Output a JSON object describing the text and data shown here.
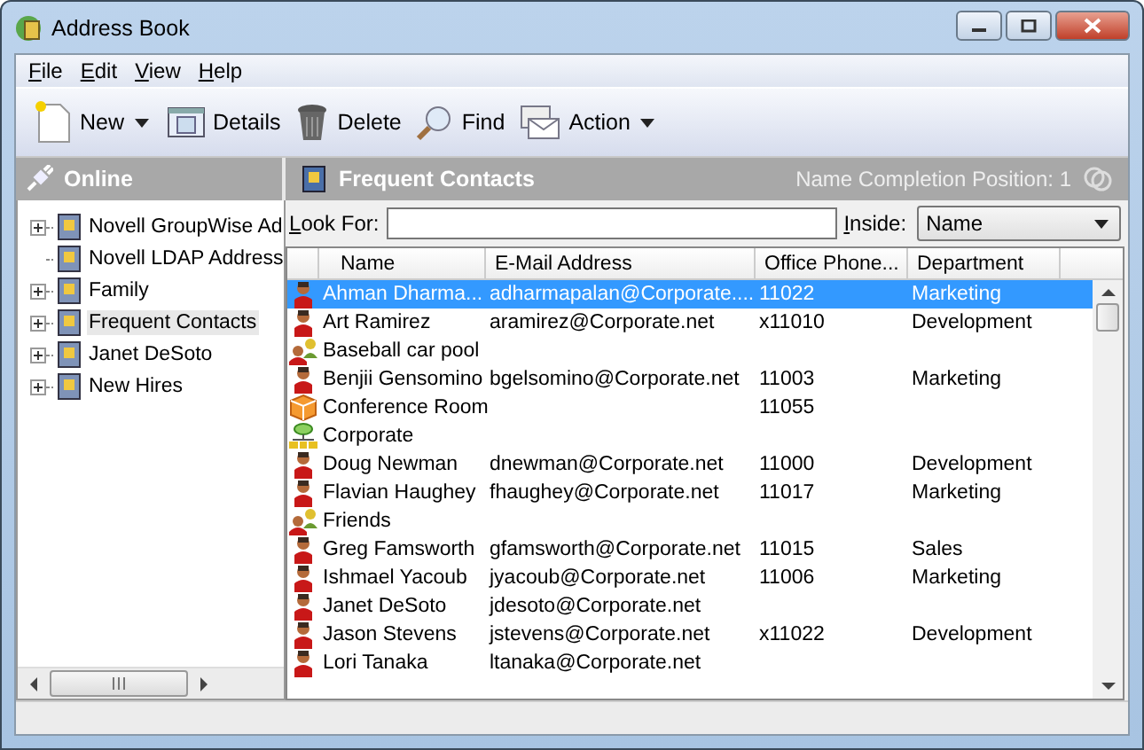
{
  "window": {
    "title": "Address Book"
  },
  "menu": [
    "File",
    "Edit",
    "View",
    "Help"
  ],
  "toolbar": [
    {
      "label": "New",
      "kind": "new",
      "dropdown": true
    },
    {
      "label": "Details",
      "kind": "details",
      "dropdown": false
    },
    {
      "label": "Delete",
      "kind": "delete",
      "dropdown": false
    },
    {
      "label": "Find",
      "kind": "find",
      "dropdown": false
    },
    {
      "label": "Action",
      "kind": "action",
      "dropdown": true
    }
  ],
  "sidebar": {
    "title": "Online",
    "items": [
      {
        "label": "Novell GroupWise Ad",
        "expandable": true,
        "selected": false
      },
      {
        "label": "Novell LDAP Address",
        "expandable": false,
        "selected": false
      },
      {
        "label": "Family",
        "expandable": true,
        "selected": false
      },
      {
        "label": "Frequent Contacts",
        "expandable": true,
        "selected": true
      },
      {
        "label": "Janet DeSoto",
        "expandable": true,
        "selected": false
      },
      {
        "label": "New Hires",
        "expandable": true,
        "selected": false
      }
    ]
  },
  "panel": {
    "title": "Frequent Contacts",
    "completion": "Name Completion Position: 1"
  },
  "search": {
    "label": "Look For:",
    "inside_label": "Inside:",
    "inside_value": "Name"
  },
  "table": {
    "columns": [
      "Name",
      "E-Mail Address",
      "Office Phone...",
      "Department"
    ],
    "rows": [
      {
        "kind": "person",
        "selected": true,
        "cells": [
          "Ahman Dharma...",
          "adharmapalan@Corporate....",
          "11022",
          "Marketing"
        ]
      },
      {
        "kind": "person",
        "selected": false,
        "cells": [
          "Art Ramirez",
          "aramirez@Corporate.net",
          "x11010",
          "Development"
        ]
      },
      {
        "kind": "group",
        "selected": false,
        "cells": [
          "Baseball car pool"
        ]
      },
      {
        "kind": "person",
        "selected": false,
        "cells": [
          "Benjii Gensomino",
          "bgelsomino@Corporate.net",
          "11003",
          "Marketing"
        ]
      },
      {
        "kind": "resource",
        "selected": false,
        "cells": [
          "Conference Room",
          "",
          "11055"
        ]
      },
      {
        "kind": "org",
        "selected": false,
        "cells": [
          "Corporate"
        ]
      },
      {
        "kind": "person",
        "selected": false,
        "cells": [
          "Doug Newman",
          "dnewman@Corporate.net",
          "11000",
          "Development"
        ]
      },
      {
        "kind": "person",
        "selected": false,
        "cells": [
          "Flavian Haughey",
          "fhaughey@Corporate.net",
          "11017",
          "Marketing"
        ]
      },
      {
        "kind": "group",
        "selected": false,
        "cells": [
          "Friends"
        ]
      },
      {
        "kind": "person",
        "selected": false,
        "cells": [
          "Greg Famsworth",
          "gfamsworth@Corporate.net",
          "11015",
          "Sales"
        ]
      },
      {
        "kind": "person",
        "selected": false,
        "cells": [
          "Ishmael Yacoub",
          "jyacoub@Corporate.net",
          "11006",
          "Marketing"
        ]
      },
      {
        "kind": "person",
        "selected": false,
        "cells": [
          "Janet DeSoto",
          "jdesoto@Corporate.net"
        ]
      },
      {
        "kind": "person",
        "selected": false,
        "cells": [
          "Jason Stevens",
          "jstevens@Corporate.net",
          "x11022",
          "Development"
        ]
      },
      {
        "kind": "person",
        "selected": false,
        "cells": [
          "Lori Tanaka",
          "ltanaka@Corporate.net"
        ]
      }
    ]
  }
}
